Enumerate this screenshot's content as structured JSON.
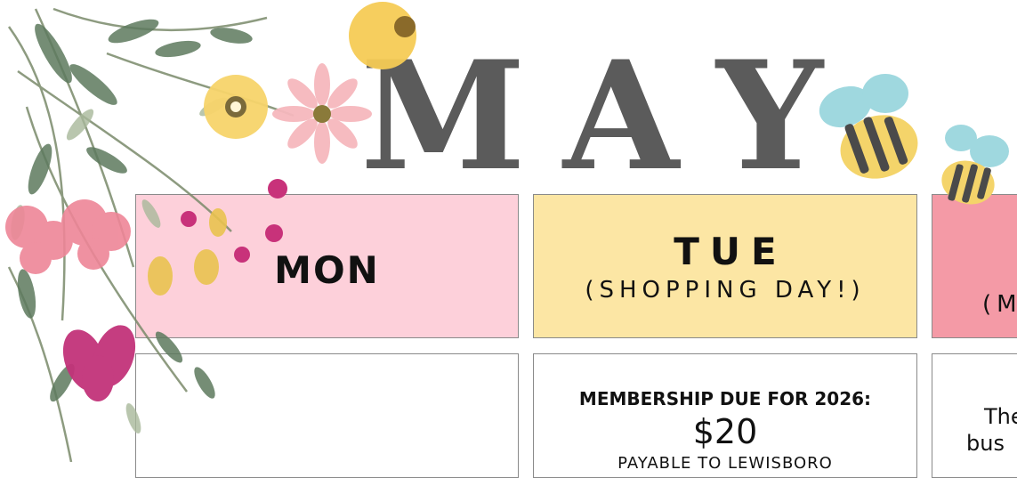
{
  "title": {
    "letters": [
      "M",
      "A",
      "Y"
    ]
  },
  "days": {
    "mon": {
      "name": "MON"
    },
    "tue": {
      "name": "TUE",
      "subtitle": "(SHOPPING DAY!)"
    },
    "wed": {
      "subtitle_partial": "(M"
    }
  },
  "cells": {
    "tue": {
      "heading": "MEMBERSHIP DUE FOR 2026:",
      "amount": "$20",
      "payee_partial": "PAYABLE TO LEWISBORO"
    },
    "wed": {
      "line1_partial": "The",
      "line2_partial": "bus "
    }
  },
  "colors": {
    "mon_header": "#fdd0da",
    "tue_header": "#fce6a4",
    "wed_header": "#f49aa6",
    "title_gray": "#5b5b5b"
  },
  "decorations": {
    "florals": "watercolor-florals-illustration",
    "bees": "bee-illustration"
  }
}
